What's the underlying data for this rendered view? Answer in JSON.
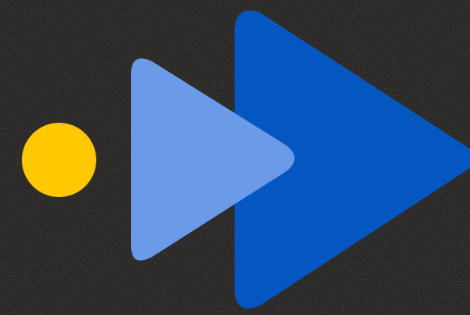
{
  "colors": {
    "background": "#f4f1ec",
    "texture": "#e6e1d9",
    "dot": "#ffc800",
    "light_triangle": "#6b9be8",
    "dark_triangle": "#0457c0"
  },
  "shapes": {
    "dot": "yellow-dot-icon",
    "small_play": "light-play-triangle-icon",
    "large_play": "dark-play-triangle-icon"
  }
}
